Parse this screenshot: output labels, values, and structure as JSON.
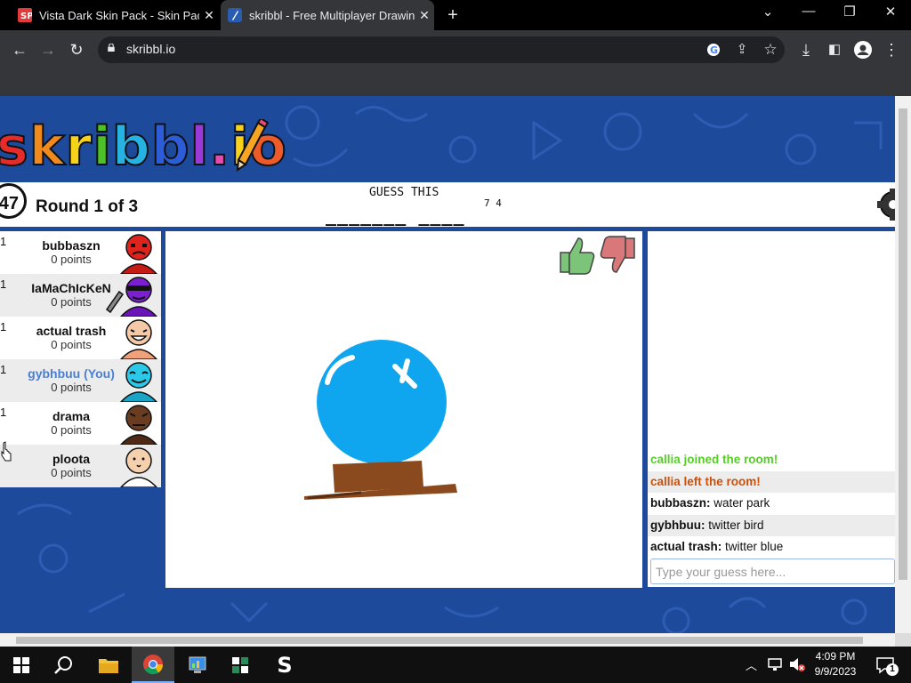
{
  "browser": {
    "tabs": [
      {
        "title": "Vista Dark Skin Pack - Skin Pack f",
        "favicon": "skinpack-favicon"
      },
      {
        "title": "skribbl - Free Multiplayer Drawing",
        "favicon": "skribbl-favicon"
      }
    ],
    "url": "skribbl.io"
  },
  "game": {
    "logo_text": "skribbl.io",
    "timer": "47",
    "round": "Round 1 of 3",
    "guess_label": "GUESS THIS",
    "word_blanks": "_______ ____",
    "word_lengths": "7 4"
  },
  "players": [
    {
      "rank": "1",
      "name": "bubbaszn",
      "points": "0 points",
      "avatar_color": "#e0231c",
      "you": false
    },
    {
      "rank": "1",
      "name": "IaMaChIcKeN",
      "points": "0 points",
      "avatar_color": "#7b1fd1",
      "you": false
    },
    {
      "rank": "1",
      "name": "actual trash",
      "points": "0 points",
      "avatar_color": "#f4c9a8",
      "you": false
    },
    {
      "rank": "1",
      "name": "gybhbuu (You)",
      "points": "0 points",
      "avatar_color": "#2bc8e8",
      "you": true
    },
    {
      "rank": "1",
      "name": "drama",
      "points": "0 points",
      "avatar_color": "#6a3c22",
      "you": false
    },
    {
      "rank": "",
      "name": "ploota",
      "points": "0 points",
      "avatar_color": "#f4d0ad",
      "you": false
    }
  ],
  "chat": {
    "messages": [
      {
        "author": "",
        "text": "callia joined the room!",
        "color": "#56ce27"
      },
      {
        "author": "",
        "text": "callia left the room!",
        "color": "#ce4f0a"
      },
      {
        "author": "bubbaszn:",
        "text": " water park",
        "color": "#111111"
      },
      {
        "author": "gybhbuu:",
        "text": " twitter bird",
        "color": "#111111"
      },
      {
        "author": "actual trash:",
        "text": " twitter blue",
        "color": "#111111"
      }
    ],
    "input_placeholder": "Type your guess here..."
  },
  "taskbar": {
    "time": "4:09 PM",
    "date": "9/9/2023",
    "notification_count": "1"
  },
  "colors": {
    "page_bg": "#1e4a9c",
    "tab_bg": "#35363a",
    "you_color": "#4a7fd0"
  }
}
